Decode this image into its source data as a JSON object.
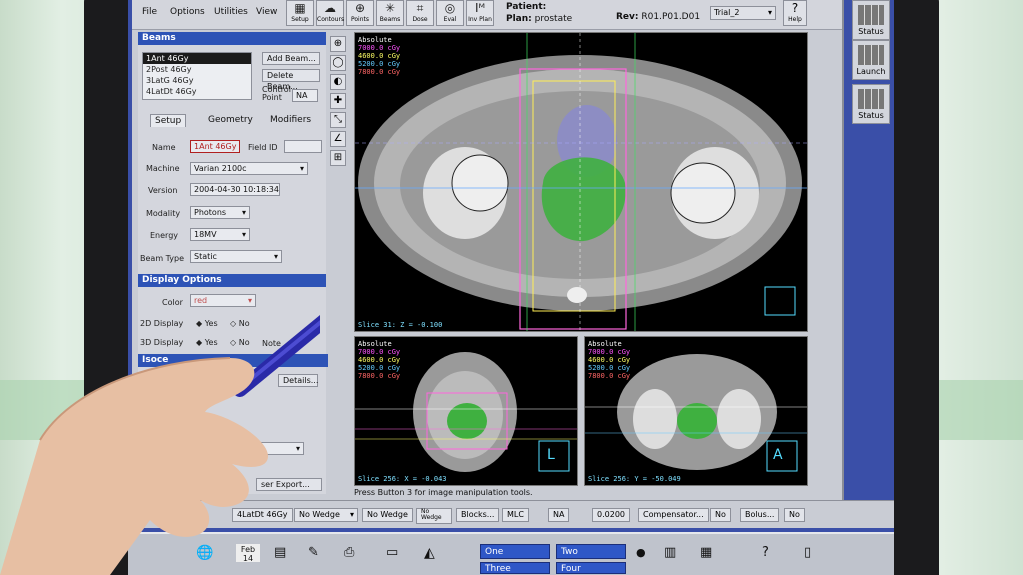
{
  "menu": [
    "File",
    "Options",
    "Utilities",
    "View"
  ],
  "toolbar": [
    "Setup",
    "Contours",
    "Points",
    "Beams",
    "Dose",
    "Eval",
    "Inv Plan"
  ],
  "patient": {
    "patient_label": "Patient:",
    "plan_label": "Plan:",
    "plan": "prostate",
    "rev_label": "Rev:",
    "rev": "R01.P01.D01",
    "trial": "Trial_2",
    "help": "Help"
  },
  "beams": {
    "header": "Beams",
    "list": [
      "1Ant 46Gy",
      "2Post 46Gy",
      "3LatG 46Gy",
      "4LatDt 46Gy"
    ],
    "add": "Add Beam...",
    "delete": "Delete Beam...",
    "control_label": "Control Point",
    "control_value": "NA"
  },
  "tabs": [
    "Setup",
    "Geometry",
    "Modifiers"
  ],
  "setup": {
    "name_label": "Name",
    "name": "1Ant 46Gy",
    "fieldid_label": "Field ID",
    "fieldid": "",
    "machine_label": "Machine",
    "machine": "Varian 2100c",
    "version_label": "Version",
    "version": "2004-04-30 10:18:34",
    "modality_label": "Modality",
    "modality": "Photons",
    "energy_label": "Energy",
    "energy": "18MV",
    "beamtype_label": "Beam Type",
    "beamtype": "Static"
  },
  "display": {
    "header": "Display Options",
    "color_label": "Color",
    "color": "red",
    "d2_label": "2D Display",
    "d3_label": "3D Display",
    "yes": "Yes",
    "no": "No",
    "note": "Note"
  },
  "iso": {
    "header": "Isoce",
    "details": "Details...",
    "export": "ser Export..."
  },
  "views": {
    "main": {
      "legend": [
        "Absolute",
        "7000.0 cGy",
        "4600.0 cGy",
        "5200.0 cGy",
        "7800.0 cGy"
      ],
      "slice": "Slice 31: Z = -0.100"
    },
    "sag": {
      "legend": [
        "Absolute",
        "7000.0 cGy",
        "4600.0 cGy",
        "5200.0 cGy",
        "7800.0 cGy"
      ],
      "slice": "Slice 256: X = -0.043",
      "orient": "L"
    },
    "cor": {
      "legend": [
        "Absolute",
        "7000.0 cGy",
        "4600.0 cGy",
        "5200.0 cGy",
        "7800.0 cGy"
      ],
      "slice": "Slice 256: Y = -50.049",
      "orient": "A"
    }
  },
  "legend_colors": [
    "#ffffff",
    "#ff55ff",
    "#ffff66",
    "#66ccff",
    "#ff6666"
  ],
  "status": "Press Button 3 for image manipulation tools.",
  "bottom": {
    "beam": "4LatDt 46Gy",
    "wedge1": "No Wedge",
    "wedge2": "No Wedge",
    "wedge_icon": "No Wedge",
    "blocks": "Blocks...",
    "mlc": "MLC",
    "na": "NA",
    "value": "0.0200",
    "comp": "Compensator...",
    "no1": "No",
    "bolus": "Bolus...",
    "no2": "No"
  },
  "taskbar": {
    "date_month": "Feb",
    "date_day": "14",
    "ws": [
      "One",
      "Two",
      "Three",
      "Four"
    ]
  },
  "dock": [
    "Status",
    "Launch",
    "Status"
  ]
}
